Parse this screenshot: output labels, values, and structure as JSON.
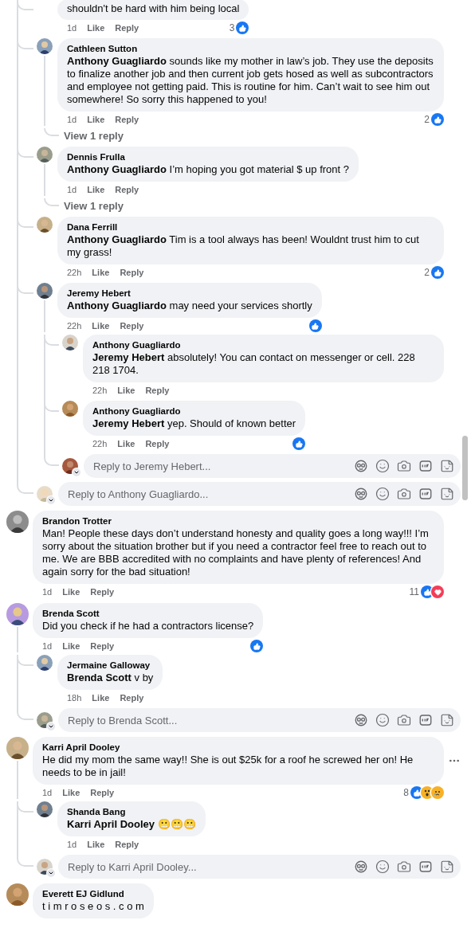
{
  "comments": [
    {
      "kind": "continued",
      "replies": [
        {
          "text": "shouldn't be hard with him being local",
          "time": "1d",
          "actions": [
            "Like",
            "Reply"
          ],
          "reactions": {
            "count": "3",
            "icons": [
              {
                "kind": "like"
              }
            ]
          }
        },
        {
          "author": "Cathleen Sutton",
          "text": "**Anthony Guagliardo** sounds like my mother in law’s job. They use the deposits to finalize another job and then current job gets hosed as well as subcontractors and employee not getting paid. This is routine for him. Can’t wait to see him out somewhere! So sorry this happened to you!",
          "time": "1d",
          "actions": [
            "Like",
            "Reply"
          ],
          "reactions": {
            "count": "2",
            "icons": [
              {
                "kind": "like"
              }
            ]
          },
          "more_replies": "View 1 reply"
        },
        {
          "author": "Dennis Frulla",
          "text": "**Anthony Guagliardo** I’m hoping you got material $ up front ?",
          "time": "1d",
          "actions": [
            "Like",
            "Reply"
          ],
          "more_replies": "View 1 reply"
        },
        {
          "author": "Dana Ferrill",
          "text": "**Anthony Guagliardo** Tim is a tool always has been! Wouldnt trust him to cut my grass!",
          "time": "22h",
          "actions": [
            "Like",
            "Reply"
          ],
          "reactions": {
            "count": "2",
            "icons": [
              {
                "kind": "like"
              }
            ]
          }
        },
        {
          "author": "Jeremy Hebert",
          "text": "**Anthony Guagliardo** may need your services shortly",
          "time": "22h",
          "actions": [
            "Like",
            "Reply"
          ],
          "reactions": {
            "icons": [
              {
                "kind": "like"
              }
            ]
          },
          "replies": [
            {
              "author": "Anthony Guagliardo",
              "text": "**Jeremy Hebert** absolutely! You can contact on messenger or cell. 228 218 1704.",
              "time": "22h",
              "actions": [
                "Like",
                "Reply"
              ]
            },
            {
              "author": "Anthony Guagliardo",
              "text": "**Jeremy Hebert** yep. Should of known better",
              "time": "22h",
              "actions": [
                "Like",
                "Reply"
              ],
              "reactions": {
                "icons": [
                  {
                    "kind": "like"
                  }
                ]
              }
            }
          ],
          "reply_box": {
            "placeholder": "Reply to Jeremy Hebert..."
          }
        }
      ],
      "reply_box": {
        "placeholder": "Reply to Anthony Guagliardo..."
      }
    },
    {
      "kind": "comment",
      "author": "Brandon Trotter",
      "text": "Man! People these days don’t understand honesty and quality goes a long way!!! I’m sorry about the situation brother but if you need a contractor feel free to reach out to me. We are BBB accredited with no complaints and have plenty of references! And again sorry for the bad situation!",
      "time": "1d",
      "actions": [
        "Like",
        "Reply"
      ],
      "reactions": {
        "count": "11",
        "icons": [
          {
            "kind": "like"
          },
          {
            "kind": "love"
          }
        ]
      }
    },
    {
      "kind": "comment",
      "author": "Brenda Scott",
      "text": "Did you check if he had a contractors license?",
      "time": "1d",
      "actions": [
        "Like",
        "Reply"
      ],
      "reactions": {
        "icons": [
          {
            "kind": "like"
          }
        ]
      },
      "replies": [
        {
          "author": "Jermaine Galloway",
          "text": "**Brenda Scott** v by",
          "time": "18h",
          "actions": [
            "Like",
            "Reply"
          ]
        }
      ],
      "reply_box": {
        "placeholder": "Reply to Brenda Scott..."
      }
    },
    {
      "kind": "comment",
      "author": "Karri April Dooley",
      "text": "He did my mom the same way!! She is out $25k for a roof he screwed her on! He needs to be in jail!",
      "time": "1d",
      "actions": [
        "Like",
        "Reply"
      ],
      "hovered": true,
      "reactions": {
        "count": "8",
        "icons": [
          {
            "kind": "like"
          },
          {
            "kind": "wow"
          },
          {
            "kind": "sad"
          }
        ]
      },
      "replies": [
        {
          "author": "Shanda Bang",
          "text": "**Karri April Dooley** 😬😬😬",
          "time": "1d",
          "actions": [
            "Like",
            "Reply"
          ]
        }
      ],
      "reply_box": {
        "placeholder": "Reply to Karri April Dooley..."
      }
    },
    {
      "kind": "comment",
      "author": "Everett EJ Gidlund",
      "text": "t i m r o s e o s . c o m"
    }
  ]
}
